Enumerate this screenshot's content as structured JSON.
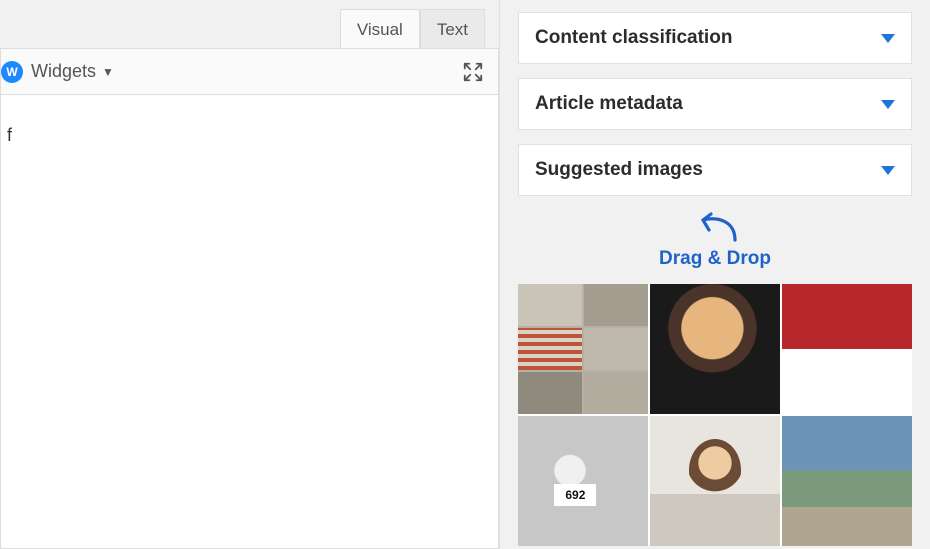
{
  "editor": {
    "tabs": {
      "visual": "Visual",
      "text": "Text"
    },
    "toolbar": {
      "widgets_label": "Widgets"
    },
    "content_fragment": "f"
  },
  "sidebar": {
    "panels": [
      {
        "label": "Content classification"
      },
      {
        "label": "Article metadata"
      },
      {
        "label": "Suggested images"
      }
    ],
    "drag_hint": "Drag & Drop",
    "suggested_images": {
      "runner_bib_number": "692"
    }
  },
  "colors": {
    "accent": "#1e77d6",
    "link": "#1e63c9",
    "flag_red": "#b6282c"
  }
}
